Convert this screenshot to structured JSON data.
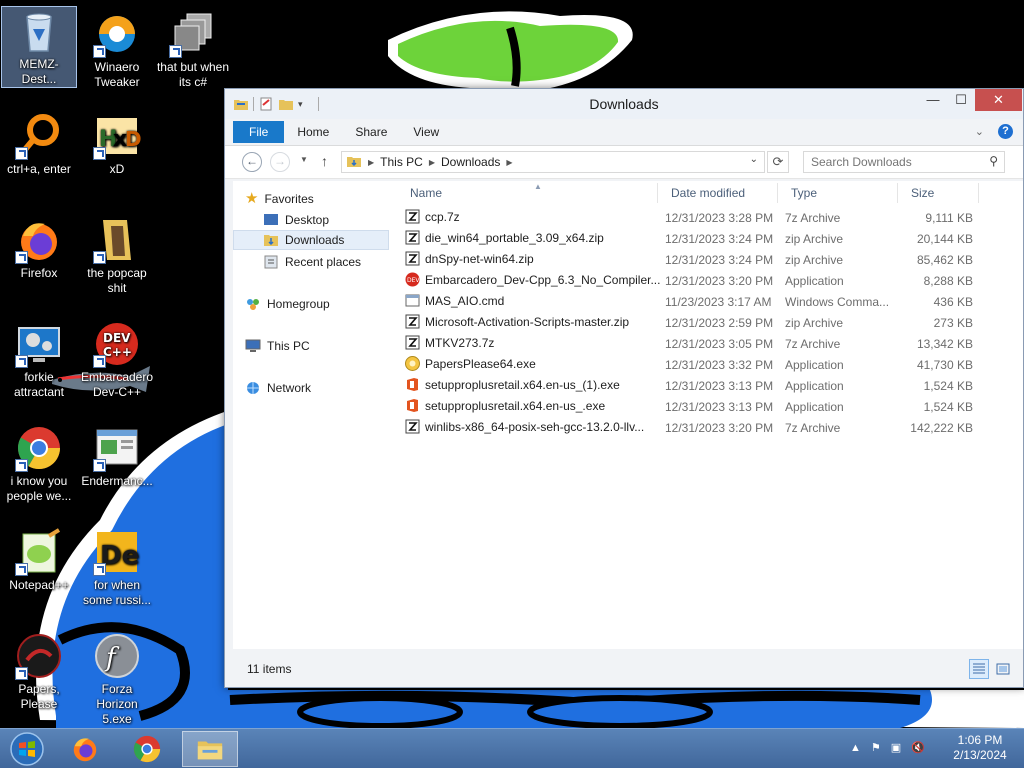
{
  "desktop": {
    "icons": [
      {
        "label": "MEMZ-Dest..."
      },
      {
        "label": "Winaero Tweaker"
      },
      {
        "label": "that but when its c#"
      },
      {
        "label": "ctrl+a, enter"
      },
      {
        "label": "xD"
      },
      {
        "label": "Firefox"
      },
      {
        "label": "the popcap shit"
      },
      {
        "label": "forkie attractant"
      },
      {
        "label": "Embarcadero Dev-C++"
      },
      {
        "label": "i know you people we..."
      },
      {
        "label": "Endermanc..."
      },
      {
        "label": "Notepad++"
      },
      {
        "label": "for when some russi..."
      },
      {
        "label": "Papers, Please"
      },
      {
        "label": "Forza Horizon 5.exe"
      }
    ]
  },
  "window": {
    "title": "Downloads",
    "controls": {
      "minimize": "—",
      "maximize": "☐",
      "close": "✕"
    },
    "ribbon": {
      "tabs": [
        "File",
        "Home",
        "Share",
        "View"
      ],
      "help": "?"
    },
    "address": {
      "segments": [
        "This PC",
        "Downloads"
      ]
    },
    "search": {
      "placeholder": "Search Downloads"
    },
    "nav_pane": {
      "favorites": "Favorites",
      "desktop": "Desktop",
      "downloads": "Downloads",
      "recent": "Recent places",
      "homegroup": "Homegroup",
      "thispc": "This PC",
      "network": "Network"
    },
    "columns": {
      "name": "Name",
      "date": "Date modified",
      "type": "Type",
      "size": "Size"
    },
    "files": [
      {
        "name": "ccp.7z",
        "date": "12/31/2023 3:28 PM",
        "type": "7z Archive",
        "size": "9,111 KB",
        "icon": "archive-icon"
      },
      {
        "name": "die_win64_portable_3.09_x64.zip",
        "date": "12/31/2023 3:24 PM",
        "type": "zip Archive",
        "size": "20,144 KB",
        "icon": "archive-icon"
      },
      {
        "name": "dnSpy-net-win64.zip",
        "date": "12/31/2023 3:24 PM",
        "type": "zip Archive",
        "size": "85,462 KB",
        "icon": "archive-icon"
      },
      {
        "name": "Embarcadero_Dev-Cpp_6.3_No_Compiler...",
        "date": "12/31/2023 3:20 PM",
        "type": "Application",
        "size": "8,288 KB",
        "icon": "devcpp-icon"
      },
      {
        "name": "MAS_AIO.cmd",
        "date": "11/23/2023 3:17 AM",
        "type": "Windows Comma...",
        "size": "436 KB",
        "icon": "cmd-icon"
      },
      {
        "name": "Microsoft-Activation-Scripts-master.zip",
        "date": "12/31/2023 2:59 PM",
        "type": "zip Archive",
        "size": "273 KB",
        "icon": "archive-icon"
      },
      {
        "name": "MTKV273.7z",
        "date": "12/31/2023 3:05 PM",
        "type": "7z Archive",
        "size": "13,342 KB",
        "icon": "archive-icon"
      },
      {
        "name": "PapersPlease64.exe",
        "date": "12/31/2023 3:32 PM",
        "type": "Application",
        "size": "41,730 KB",
        "icon": "papers-icon"
      },
      {
        "name": "setupproplusretail.x64.en-us_(1).exe",
        "date": "12/31/2023 3:13 PM",
        "type": "Application",
        "size": "1,524 KB",
        "icon": "office-icon"
      },
      {
        "name": "setupproplusretail.x64.en-us_.exe",
        "date": "12/31/2023 3:13 PM",
        "type": "Application",
        "size": "1,524 KB",
        "icon": "office-icon"
      },
      {
        "name": "winlibs-x86_64-posix-seh-gcc-13.2.0-llv...",
        "date": "12/31/2023 3:20 PM",
        "type": "7z Archive",
        "size": "142,222 KB",
        "icon": "archive-icon"
      }
    ],
    "status": "11 items"
  },
  "taskbar": {
    "clock_time": "1:06 PM",
    "clock_date": "2/13/2024"
  },
  "colors": {
    "accent": "#1979ca",
    "wallpaper_blue": "#1f6fe0",
    "wallpaper_green": "#6dd33a",
    "taskbar": "#4a73a8"
  }
}
